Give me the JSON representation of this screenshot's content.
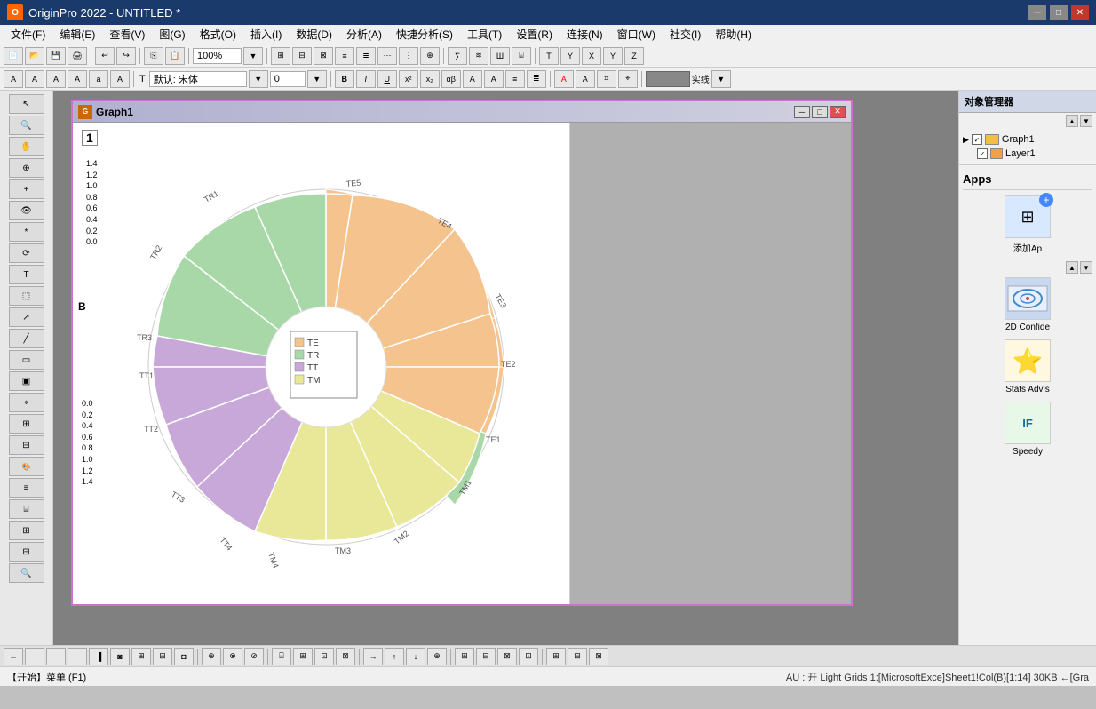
{
  "titleBar": {
    "appName": "OriginPro 2022 - UNTITLED *",
    "icon": "O"
  },
  "menuBar": {
    "items": [
      "文件(F)",
      "编辑(E)",
      "查看(V)",
      "图(G)",
      "格式(O)",
      "插入(I)",
      "数据(D)",
      "分析(A)",
      "快捷分析(S)",
      "工具(T)",
      "设置(R)",
      "连接(N)",
      "窗口(W)",
      "社交(I)",
      "帮助(H)"
    ]
  },
  "toolbar1": {
    "zoomLevel": "100%"
  },
  "fontToolbar": {
    "fontName": "默认: 宋体",
    "fontSize": "0"
  },
  "graphWindow": {
    "title": "Graph1",
    "layerNum": "1"
  },
  "yAxisTop": {
    "labels": [
      "1.4",
      "1.2",
      "1.0",
      "0.8",
      "0.6",
      "0.4",
      "0.2",
      "0.0"
    ]
  },
  "yAxisBottom": {
    "labels": [
      "0.0",
      "0.2",
      "0.4",
      "0.6",
      "0.8",
      "1.0",
      "1.2",
      "1.4"
    ]
  },
  "legend": {
    "items": [
      {
        "label": "TE",
        "color": "#f4c38e"
      },
      {
        "label": "TR",
        "color": "#a8d8a8"
      },
      {
        "label": "TT",
        "color": "#c8a8d8"
      },
      {
        "label": "TM",
        "color": "#e8e898"
      }
    ]
  },
  "chartLabels": {
    "te": [
      "TE5",
      "TE4",
      "TE3",
      "TE2",
      "TE1"
    ],
    "tr": [
      "TR1",
      "TR2",
      "TR3"
    ],
    "tt": [
      "TT1",
      "TT2",
      "TT3",
      "TT4"
    ],
    "tm": [
      "TM1",
      "TM2",
      "TM3",
      "TM4"
    ]
  },
  "objectManager": {
    "title": "对象管理器",
    "treeItems": [
      {
        "label": "Graph1",
        "type": "folder"
      },
      {
        "label": "Layer1",
        "type": "layer",
        "checked": true
      }
    ],
    "layerColor": "#f4a040"
  },
  "appsPanel": {
    "title": "Apps",
    "addLabel": "添加Ap",
    "apps": [
      {
        "name": "2D Confide",
        "icon": "📊"
      },
      {
        "name": "Stats Advis",
        "icon": "⭐"
      },
      {
        "name": "Speedy",
        "icon": "IF"
      }
    ]
  },
  "statusBar": {
    "left": "【开始】菜单 (F1)",
    "right": "AU : 开  Light Grids 1:[MicrosoftExce]Sheet1!Col(B)[1:14] 30KB ←[Gra"
  },
  "bottomToolbar": {
    "items": [
      "←",
      "·",
      "·",
      "·",
      "·"
    ]
  }
}
